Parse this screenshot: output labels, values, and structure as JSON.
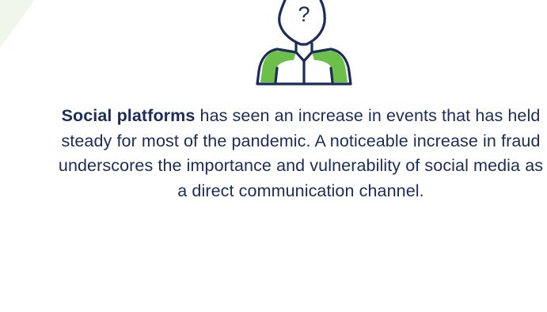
{
  "colors": {
    "text": "#1b2c59",
    "accent_green": "#6cc04a",
    "corner_tint": "#f0f6ea",
    "icon_outline": "#1b2c59"
  },
  "icon": {
    "name": "confused-person-icon",
    "glyph": "?"
  },
  "caption": {
    "highlight": "Social platforms",
    "body": " has seen an increase in events that has held steady for most of the pandemic. A noticeable increase in fraud underscores the importance and vulnerability of social media as a direct communication channel."
  }
}
